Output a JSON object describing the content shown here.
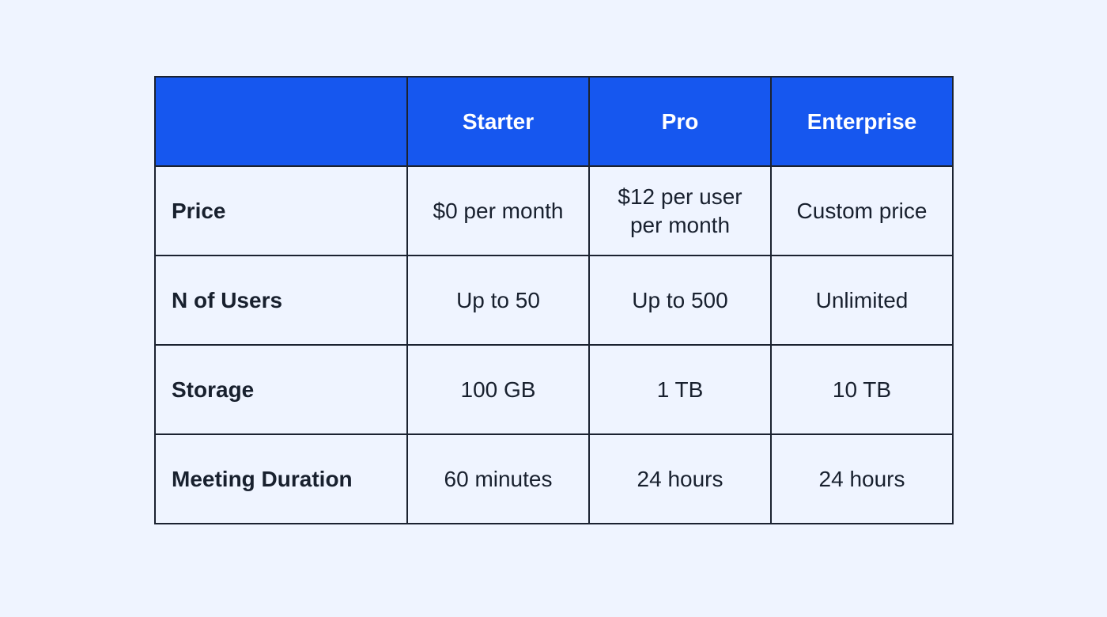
{
  "table": {
    "headers": [
      "",
      "Starter",
      "Pro",
      "Enterprise"
    ],
    "rows": [
      {
        "label": "Price",
        "values": [
          "$0 per month",
          "$12 per user per month",
          "Custom price"
        ]
      },
      {
        "label": "N of Users",
        "values": [
          "Up to 50",
          "Up to 500",
          "Unlimited"
        ]
      },
      {
        "label": "Storage",
        "values": [
          "100 GB",
          "1 TB",
          "10 TB"
        ]
      },
      {
        "label": "Meeting Duration",
        "values": [
          "60 minutes",
          "24 hours",
          "24 hours"
        ]
      }
    ]
  },
  "colors": {
    "header_bg": "#1657ef",
    "header_text": "#ffffff",
    "page_bg": "#eff4ff",
    "border": "#1b2230"
  }
}
